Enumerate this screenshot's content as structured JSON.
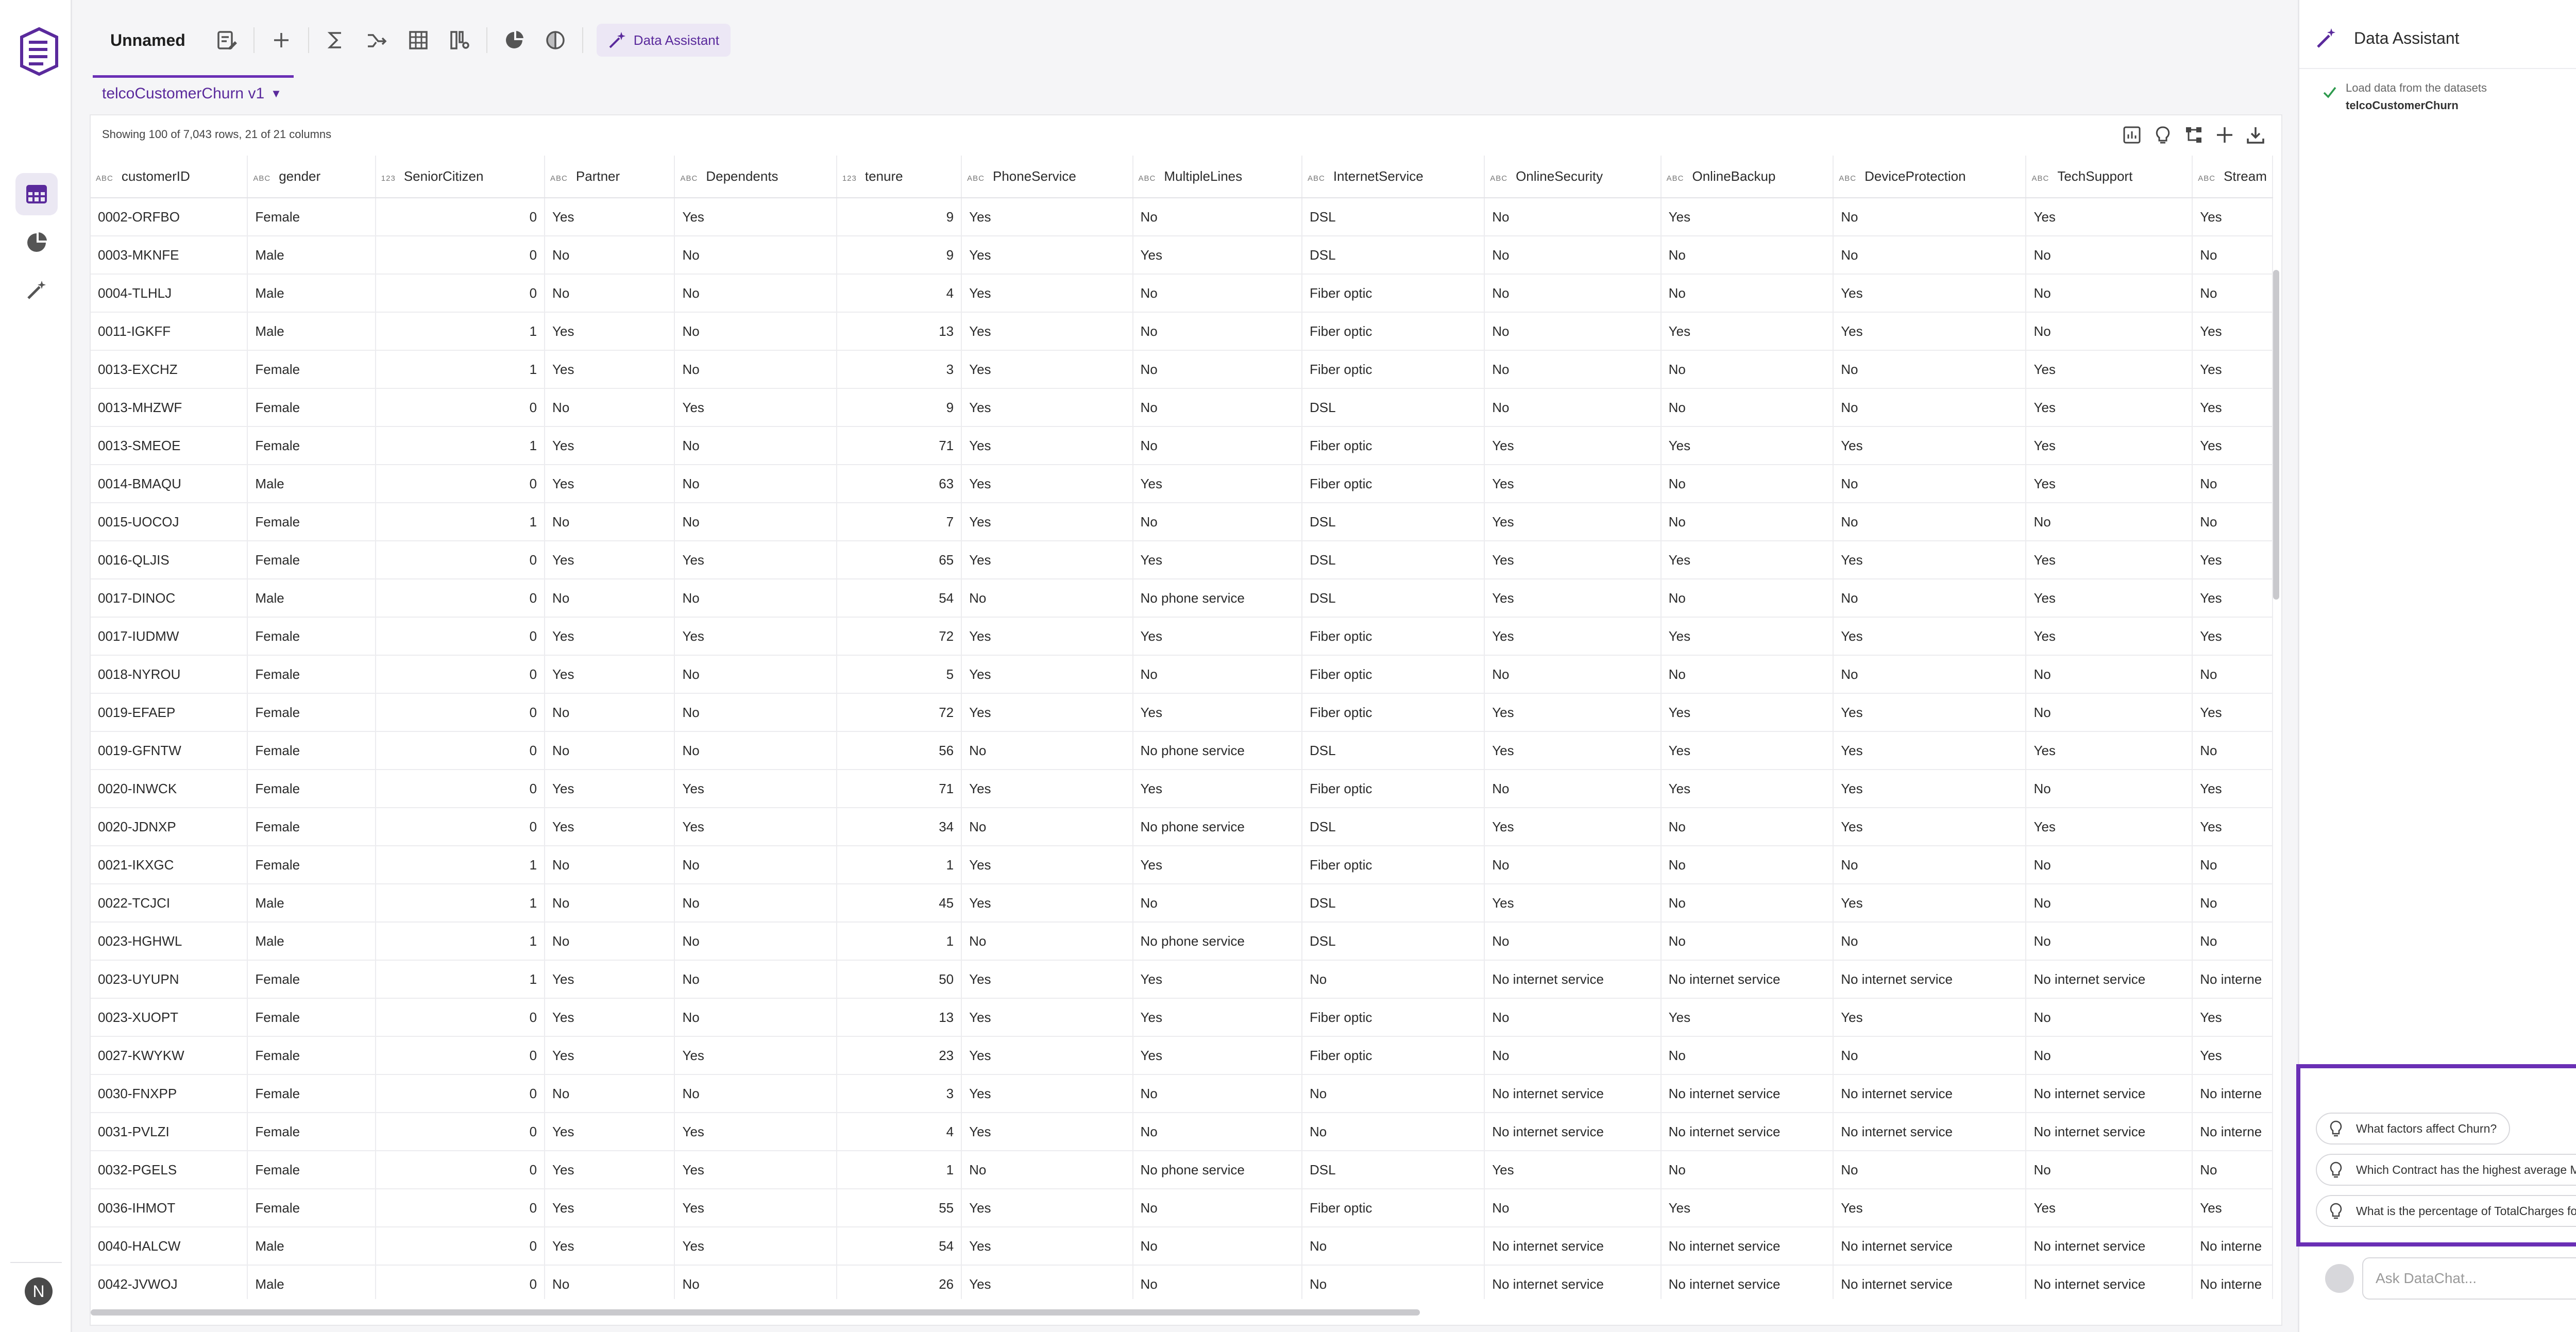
{
  "toolbar": {
    "doc_title": "Unnamed",
    "data_assistant_label": "Data Assistant"
  },
  "tab": {
    "label": "telcoCustomerChurn v1"
  },
  "summary": "Showing 100 of 7,043 rows, 21 of 21 columns",
  "table": {
    "columns": [
      {
        "type": "ABC",
        "name": "customerID"
      },
      {
        "type": "ABC",
        "name": "gender"
      },
      {
        "type": "123",
        "name": "SeniorCitizen"
      },
      {
        "type": "ABC",
        "name": "Partner"
      },
      {
        "type": "ABC",
        "name": "Dependents"
      },
      {
        "type": "123",
        "name": "tenure"
      },
      {
        "type": "ABC",
        "name": "PhoneService"
      },
      {
        "type": "ABC",
        "name": "MultipleLines"
      },
      {
        "type": "ABC",
        "name": "InternetService"
      },
      {
        "type": "ABC",
        "name": "OnlineSecurity"
      },
      {
        "type": "ABC",
        "name": "OnlineBackup"
      },
      {
        "type": "ABC",
        "name": "DeviceProtection"
      },
      {
        "type": "ABC",
        "name": "TechSupport"
      },
      {
        "type": "ABC",
        "name": "Stream"
      }
    ],
    "rows": [
      [
        "0002-ORFBO",
        "Female",
        "0",
        "Yes",
        "Yes",
        "9",
        "Yes",
        "No",
        "DSL",
        "No",
        "Yes",
        "No",
        "Yes",
        "Yes"
      ],
      [
        "0003-MKNFE",
        "Male",
        "0",
        "No",
        "No",
        "9",
        "Yes",
        "Yes",
        "DSL",
        "No",
        "No",
        "No",
        "No",
        "No"
      ],
      [
        "0004-TLHLJ",
        "Male",
        "0",
        "No",
        "No",
        "4",
        "Yes",
        "No",
        "Fiber optic",
        "No",
        "No",
        "Yes",
        "No",
        "No"
      ],
      [
        "0011-IGKFF",
        "Male",
        "1",
        "Yes",
        "No",
        "13",
        "Yes",
        "No",
        "Fiber optic",
        "No",
        "Yes",
        "Yes",
        "No",
        "Yes"
      ],
      [
        "0013-EXCHZ",
        "Female",
        "1",
        "Yes",
        "No",
        "3",
        "Yes",
        "No",
        "Fiber optic",
        "No",
        "No",
        "No",
        "Yes",
        "Yes"
      ],
      [
        "0013-MHZWF",
        "Female",
        "0",
        "No",
        "Yes",
        "9",
        "Yes",
        "No",
        "DSL",
        "No",
        "No",
        "No",
        "Yes",
        "Yes"
      ],
      [
        "0013-SMEOE",
        "Female",
        "1",
        "Yes",
        "No",
        "71",
        "Yes",
        "No",
        "Fiber optic",
        "Yes",
        "Yes",
        "Yes",
        "Yes",
        "Yes"
      ],
      [
        "0014-BMAQU",
        "Male",
        "0",
        "Yes",
        "No",
        "63",
        "Yes",
        "Yes",
        "Fiber optic",
        "Yes",
        "No",
        "No",
        "Yes",
        "No"
      ],
      [
        "0015-UOCOJ",
        "Female",
        "1",
        "No",
        "No",
        "7",
        "Yes",
        "No",
        "DSL",
        "Yes",
        "No",
        "No",
        "No",
        "No"
      ],
      [
        "0016-QLJIS",
        "Female",
        "0",
        "Yes",
        "Yes",
        "65",
        "Yes",
        "Yes",
        "DSL",
        "Yes",
        "Yes",
        "Yes",
        "Yes",
        "Yes"
      ],
      [
        "0017-DINOC",
        "Male",
        "0",
        "No",
        "No",
        "54",
        "No",
        "No phone service",
        "DSL",
        "Yes",
        "No",
        "No",
        "Yes",
        "Yes"
      ],
      [
        "0017-IUDMW",
        "Female",
        "0",
        "Yes",
        "Yes",
        "72",
        "Yes",
        "Yes",
        "Fiber optic",
        "Yes",
        "Yes",
        "Yes",
        "Yes",
        "Yes"
      ],
      [
        "0018-NYROU",
        "Female",
        "0",
        "Yes",
        "No",
        "5",
        "Yes",
        "No",
        "Fiber optic",
        "No",
        "No",
        "No",
        "No",
        "No"
      ],
      [
        "0019-EFAEP",
        "Female",
        "0",
        "No",
        "No",
        "72",
        "Yes",
        "Yes",
        "Fiber optic",
        "Yes",
        "Yes",
        "Yes",
        "No",
        "Yes"
      ],
      [
        "0019-GFNTW",
        "Female",
        "0",
        "No",
        "No",
        "56",
        "No",
        "No phone service",
        "DSL",
        "Yes",
        "Yes",
        "Yes",
        "Yes",
        "No"
      ],
      [
        "0020-INWCK",
        "Female",
        "0",
        "Yes",
        "Yes",
        "71",
        "Yes",
        "Yes",
        "Fiber optic",
        "No",
        "Yes",
        "Yes",
        "No",
        "Yes"
      ],
      [
        "0020-JDNXP",
        "Female",
        "0",
        "Yes",
        "Yes",
        "34",
        "No",
        "No phone service",
        "DSL",
        "Yes",
        "No",
        "Yes",
        "Yes",
        "Yes"
      ],
      [
        "0021-IKXGC",
        "Female",
        "1",
        "No",
        "No",
        "1",
        "Yes",
        "Yes",
        "Fiber optic",
        "No",
        "No",
        "No",
        "No",
        "No"
      ],
      [
        "0022-TCJCI",
        "Male",
        "1",
        "No",
        "No",
        "45",
        "Yes",
        "No",
        "DSL",
        "Yes",
        "No",
        "Yes",
        "No",
        "No"
      ],
      [
        "0023-HGHWL",
        "Male",
        "1",
        "No",
        "No",
        "1",
        "No",
        "No phone service",
        "DSL",
        "No",
        "No",
        "No",
        "No",
        "No"
      ],
      [
        "0023-UYUPN",
        "Female",
        "1",
        "Yes",
        "No",
        "50",
        "Yes",
        "Yes",
        "No",
        "No internet service",
        "No internet service",
        "No internet service",
        "No internet service",
        "No interne"
      ],
      [
        "0023-XUOPT",
        "Female",
        "0",
        "Yes",
        "No",
        "13",
        "Yes",
        "Yes",
        "Fiber optic",
        "No",
        "Yes",
        "Yes",
        "No",
        "Yes"
      ],
      [
        "0027-KWYKW",
        "Female",
        "0",
        "Yes",
        "Yes",
        "23",
        "Yes",
        "Yes",
        "Fiber optic",
        "No",
        "No",
        "No",
        "No",
        "Yes"
      ],
      [
        "0030-FNXPP",
        "Female",
        "0",
        "No",
        "No",
        "3",
        "Yes",
        "No",
        "No",
        "No internet service",
        "No internet service",
        "No internet service",
        "No internet service",
        "No interne"
      ],
      [
        "0031-PVLZI",
        "Female",
        "0",
        "Yes",
        "Yes",
        "4",
        "Yes",
        "No",
        "No",
        "No internet service",
        "No internet service",
        "No internet service",
        "No internet service",
        "No interne"
      ],
      [
        "0032-PGELS",
        "Female",
        "0",
        "Yes",
        "Yes",
        "1",
        "No",
        "No phone service",
        "DSL",
        "Yes",
        "No",
        "No",
        "No",
        "No"
      ],
      [
        "0036-IHMOT",
        "Female",
        "0",
        "Yes",
        "Yes",
        "55",
        "Yes",
        "No",
        "Fiber optic",
        "No",
        "Yes",
        "Yes",
        "Yes",
        "Yes"
      ],
      [
        "0040-HALCW",
        "Male",
        "0",
        "Yes",
        "Yes",
        "54",
        "Yes",
        "No",
        "No",
        "No internet service",
        "No internet service",
        "No internet service",
        "No internet service",
        "No interne"
      ],
      [
        "0042-JVWOJ",
        "Male",
        "0",
        "No",
        "No",
        "26",
        "Yes",
        "No",
        "No",
        "No internet service",
        "No internet service",
        "No internet service",
        "No internet service",
        "No interne"
      ]
    ]
  },
  "assistant": {
    "title": "Data Assistant",
    "step_title": "Load data from the datasets",
    "step_dataset": "telcoCustomerChurn",
    "suggestions": [
      "What factors affect Churn?",
      "Which Contract has the highest average M...",
      "What is the percentage of TotalCharges for..."
    ],
    "input_placeholder": "Ask DataChat..."
  },
  "user": {
    "initial": "N"
  },
  "colors": {
    "accent": "#6a2fb5",
    "accent_bg": "#ece7f5"
  }
}
